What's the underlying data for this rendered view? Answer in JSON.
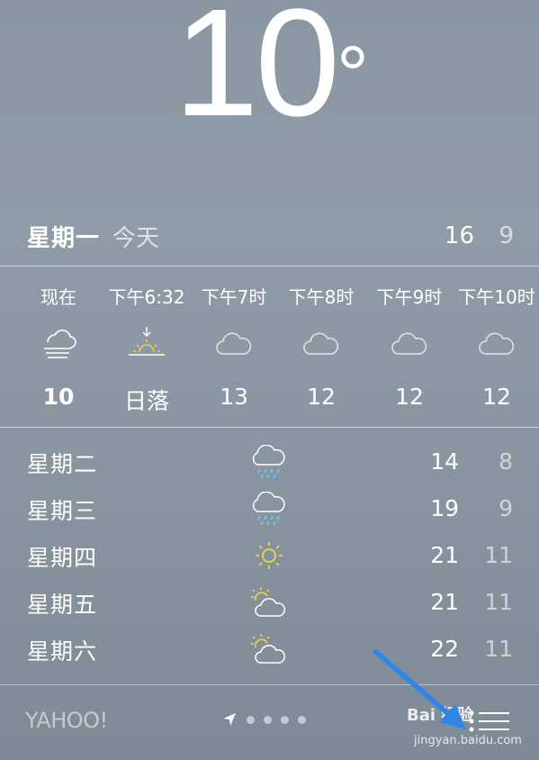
{
  "current": {
    "temperature": "10",
    "degree_symbol": "°"
  },
  "today": {
    "day": "星期一",
    "label": "今天",
    "high": "16",
    "low": "9"
  },
  "hourly": [
    {
      "time": "现在",
      "icon": "fog-icon",
      "temp": "10",
      "bold": true
    },
    {
      "time": "下午6:32",
      "icon": "sunset-icon",
      "temp": "日落",
      "bold": false
    },
    {
      "time": "下午7时",
      "icon": "cloud-icon",
      "temp": "13",
      "bold": false
    },
    {
      "time": "下午8时",
      "icon": "cloud-icon",
      "temp": "12",
      "bold": false
    },
    {
      "time": "下午9时",
      "icon": "cloud-icon",
      "temp": "12",
      "bold": false
    },
    {
      "time": "下午10时",
      "icon": "cloud-icon",
      "temp": "12",
      "bold": false
    }
  ],
  "daily": [
    {
      "day": "星期二",
      "icon": "rain-cloud-icon",
      "high": "14",
      "low": "8"
    },
    {
      "day": "星期三",
      "icon": "rain-cloud-icon",
      "high": "19",
      "low": "9"
    },
    {
      "day": "星期四",
      "icon": "sun-icon",
      "high": "21",
      "low": "11"
    },
    {
      "day": "星期五",
      "icon": "partly-cloudy-icon",
      "high": "21",
      "low": "11"
    },
    {
      "day": "星期六",
      "icon": "partly-cloudy-icon",
      "high": "22",
      "low": "11"
    }
  ],
  "footer": {
    "provider": "YAHOO!",
    "watermark": "Bai 经验",
    "watermark_url": "jingyan.baidu.com"
  },
  "colors": {
    "sun": "#f0d34a",
    "rain": "#6fc3f0",
    "annotation_arrow": "#2f86e6"
  }
}
